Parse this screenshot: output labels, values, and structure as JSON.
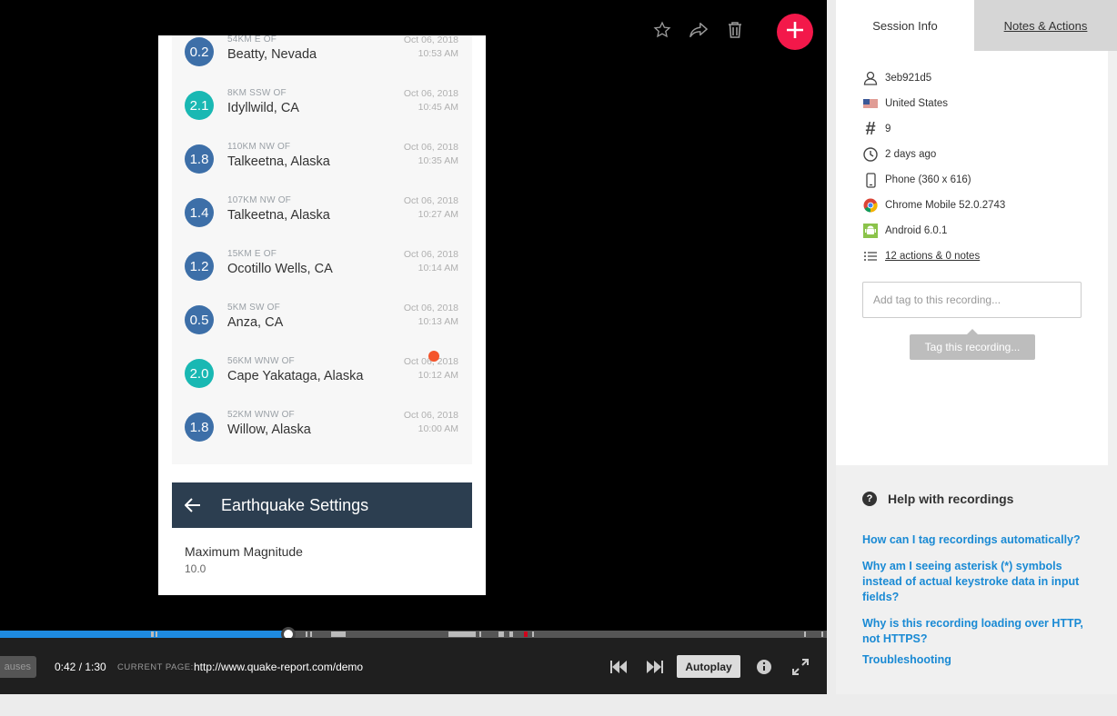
{
  "quakes": [
    {
      "mag": "0.2",
      "color": "#3d6fa8",
      "dir": "54KM E OF",
      "city": "Beatty, Nevada",
      "date": "Oct 06, 2018",
      "time": "10:53 AM"
    },
    {
      "mag": "2.1",
      "color": "#19b8b3",
      "dir": "8KM SSW OF",
      "city": "Idyllwild, CA",
      "date": "Oct 06, 2018",
      "time": "10:45 AM"
    },
    {
      "mag": "1.8",
      "color": "#3d6fa8",
      "dir": "110KM NW OF",
      "city": "Talkeetna, Alaska",
      "date": "Oct 06, 2018",
      "time": "10:35 AM"
    },
    {
      "mag": "1.4",
      "color": "#3d6fa8",
      "dir": "107KM NW OF",
      "city": "Talkeetna, Alaska",
      "date": "Oct 06, 2018",
      "time": "10:27 AM"
    },
    {
      "mag": "1.2",
      "color": "#3d6fa8",
      "dir": "15KM E OF",
      "city": "Ocotillo Wells, CA",
      "date": "Oct 06, 2018",
      "time": "10:14 AM"
    },
    {
      "mag": "0.5",
      "color": "#3d6fa8",
      "dir": "5KM SW OF",
      "city": "Anza, CA",
      "date": "Oct 06, 2018",
      "time": "10:13 AM"
    },
    {
      "mag": "2.0",
      "color": "#19b8b3",
      "dir": "56KM WNW OF",
      "city": "Cape Yakataga, Alaska",
      "date": "Oct 06, 2018",
      "time": "10:12 AM"
    },
    {
      "mag": "1.8",
      "color": "#3d6fa8",
      "dir": "52KM WNW OF",
      "city": "Willow, Alaska",
      "date": "Oct 06, 2018",
      "time": "10:00 AM"
    }
  ],
  "settings": {
    "title": "Earthquake Settings",
    "max_label": "Maximum Magnitude",
    "max_value": "10.0"
  },
  "player": {
    "pauses_label": "auses",
    "time": "0:42 / 1:30",
    "current_page_label": "CURRENT PAGE:",
    "current_page_url": "http://www.quake-report.com/demo",
    "autoplay_label": "Autoplay",
    "progress": 0.349
  },
  "tabs": {
    "session": "Session Info",
    "notes": "Notes & Actions"
  },
  "session": {
    "user_id": "3eb921d5",
    "country": "United States",
    "count": "9",
    "when": "2 days ago",
    "device": "Phone (360 x 616)",
    "browser": "Chrome Mobile 52.0.2743",
    "os": "Android 6.0.1",
    "actions": "12 actions & 0 notes",
    "tag_placeholder": "Add tag to this recording...",
    "tag_button": "Tag this recording..."
  },
  "help": {
    "title": "Help with recordings",
    "links": [
      "How can I tag recordings automatically?",
      "Why am I seeing asterisk (*) symbols instead of actual keystroke data in input fields?",
      "Why is this recording loading over HTTP, not HTTPS?",
      "Troubleshooting"
    ]
  },
  "icons": {
    "favorite": "star-icon",
    "share": "share-icon",
    "delete": "trash-icon",
    "add": "plus-icon"
  }
}
